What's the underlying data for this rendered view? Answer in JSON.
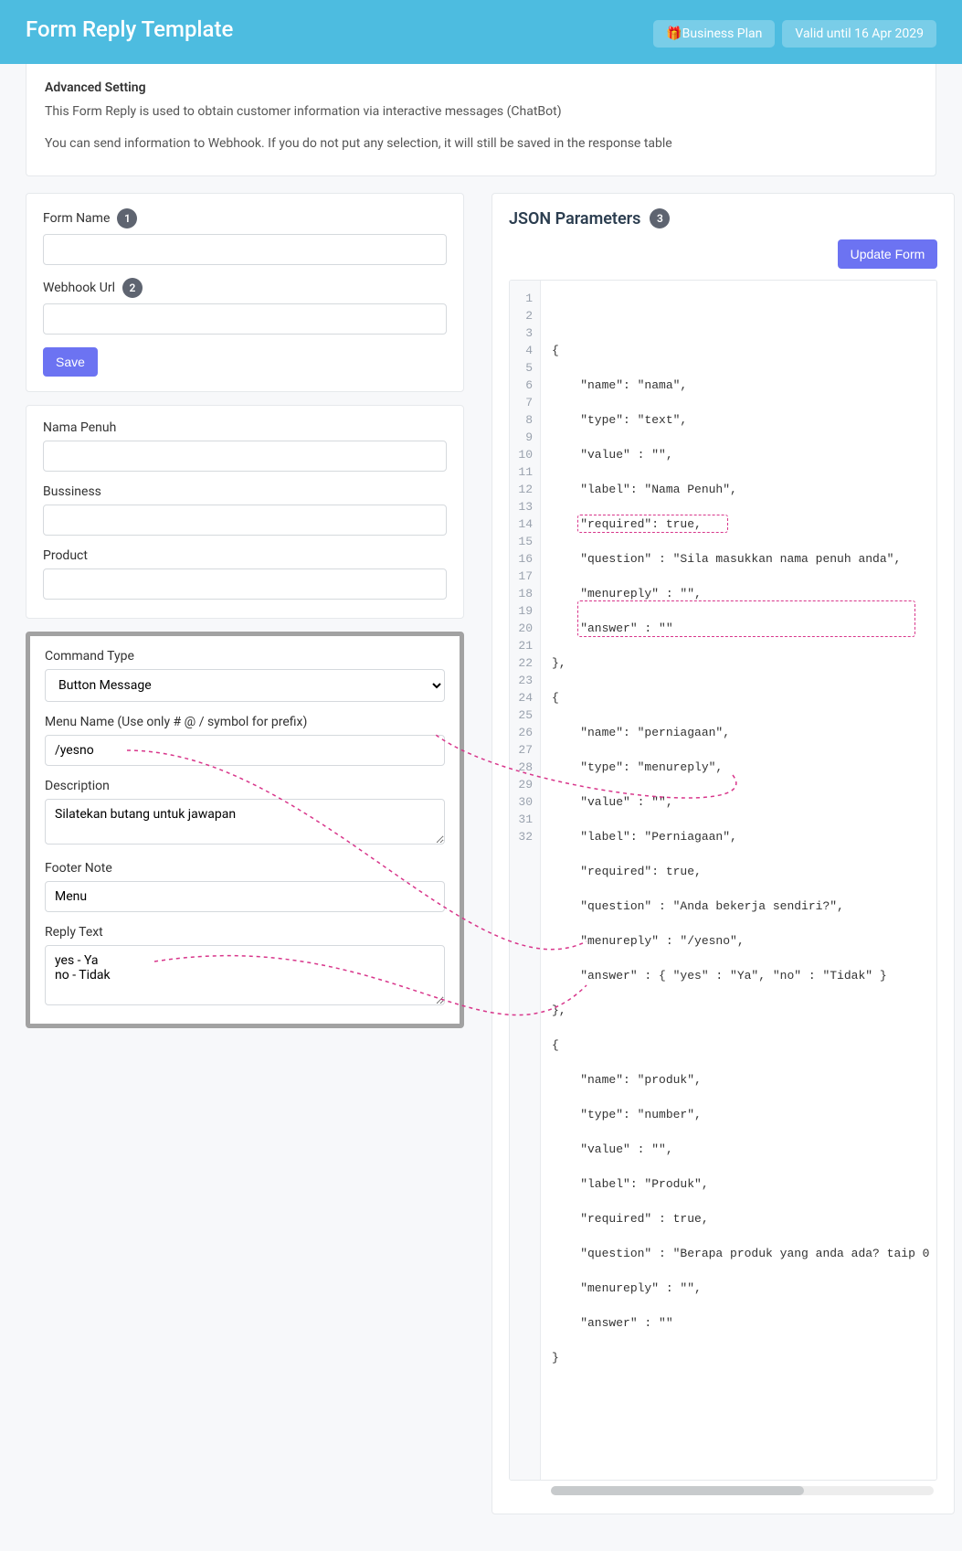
{
  "header": {
    "title": "Form Reply Template",
    "plan_emoji": "🎁",
    "plan_label": "Business Plan",
    "valid_label": "Valid until 16 Apr 2029"
  },
  "advanced": {
    "heading": "Advanced Setting",
    "line1": "This Form Reply is used to obtain customer information via interactive messages (ChatBot)",
    "line2": "You can send information to Webhook. If you do not put any selection, it will still be saved in the response table"
  },
  "form_settings": {
    "form_name_label": "Form Name",
    "form_name_value": "",
    "webhook_label": "Webhook Url",
    "webhook_value": "",
    "save_label": "Save"
  },
  "form_fields": {
    "f1_label": "Nama Penuh",
    "f1_value": "",
    "f2_label": "Bussiness",
    "f2_value": "",
    "f3_label": "Product",
    "f3_value": ""
  },
  "command": {
    "command_type_label": "Command Type",
    "command_type_value": "Button Message",
    "menu_name_label": "Menu Name (Use only # @ / symbol for prefix)",
    "menu_name_value": "/yesno",
    "description_label": "Description",
    "description_value": "Silatekan butang untuk jawapan",
    "footer_label": "Footer Note",
    "footer_value": "Menu",
    "reply_text_label": "Reply Text",
    "reply_text_value": "yes - Ya\nno - Tidak"
  },
  "json_panel": {
    "title": "JSON Parameters",
    "update_label": "Update Form",
    "lines": {
      "l1": "{",
      "l2": "    \"name\": \"nama\",",
      "l3": "    \"type\": \"text\",",
      "l4": "    \"value\" : \"\",",
      "l5": "    \"label\": \"Nama Penuh\",",
      "l6": "    \"required\": true,",
      "l7": "    \"question\" : \"Sila masukkan nama penuh anda\",",
      "l8": "    \"menureply\" : \"\",",
      "l9": "    \"answer\" : \"\"",
      "l10": "},",
      "l11": "{",
      "l12": "    \"name\": \"perniagaan\",",
      "l13": "    \"type\": \"menureply\",",
      "l14": "    \"value\" : \"\",",
      "l15": "    \"label\": \"Perniagaan\",",
      "l16": "    \"required\": true,",
      "l17": "    \"question\" : \"Anda bekerja sendiri?\",",
      "l18": "    \"menureply\" : \"/yesno\",",
      "l19": "    \"answer\" : { \"yes\" : \"Ya\", \"no\" : \"Tidak\" }",
      "l20": "},",
      "l21": "{",
      "l22": "    \"name\": \"produk\",",
      "l23": "    \"type\": \"number\",",
      "l24": "    \"value\" : \"\",",
      "l25": "    \"label\": \"Produk\",",
      "l26": "    \"required\" : true,",
      "l27": "    \"question\" : \"Berapa produk yang anda ada? taip 0 ",
      "l28": "    \"menureply\" : \"\",",
      "l29": "    \"answer\" : \"\"",
      "l30": "}",
      "l31": ""
    }
  }
}
